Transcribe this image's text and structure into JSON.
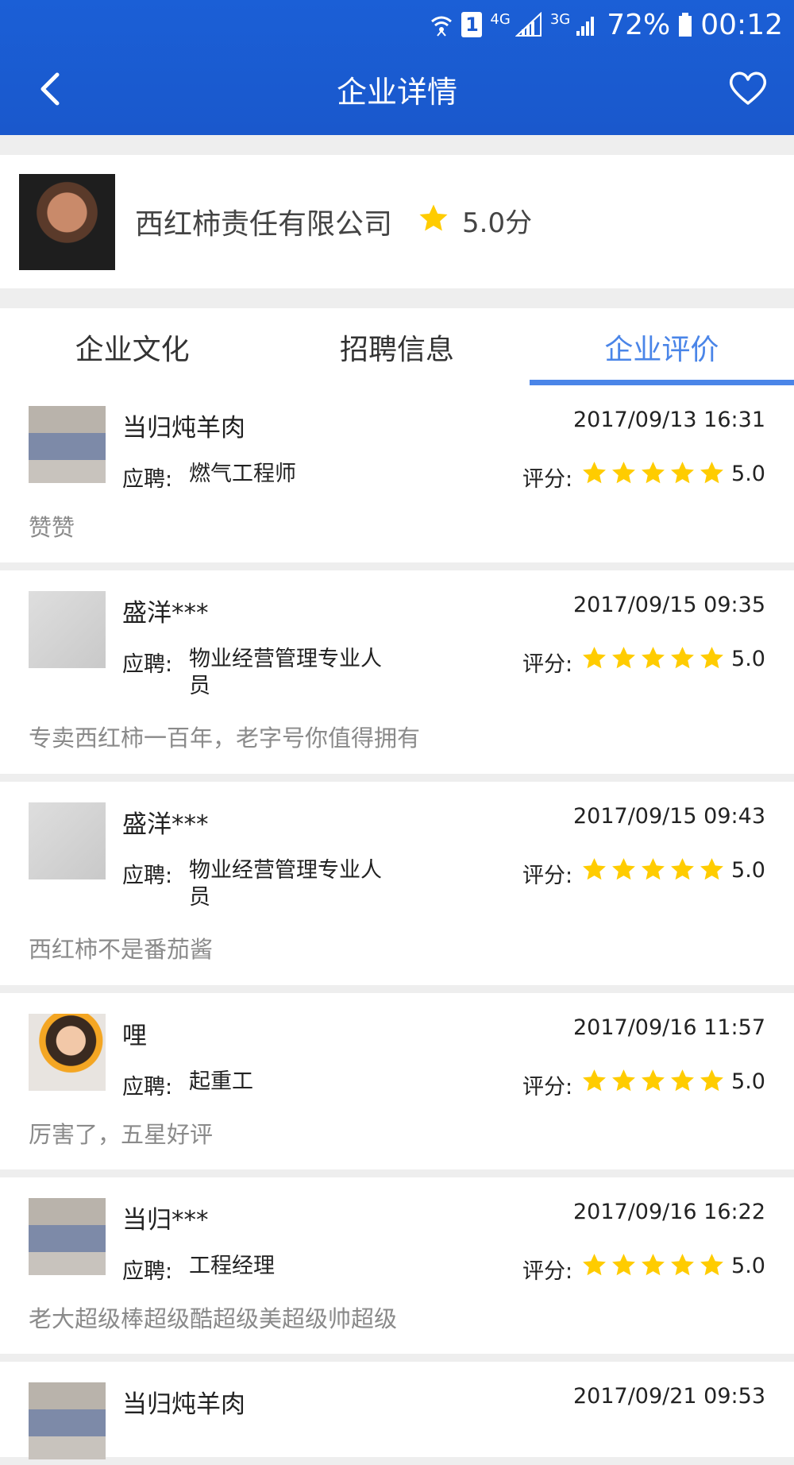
{
  "status_bar": {
    "network1": "4G",
    "network2": "3G",
    "sim": "1",
    "battery": "72%",
    "time": "00:12"
  },
  "header": {
    "title": "企业详情"
  },
  "company": {
    "name": "西红柿责任有限公司",
    "score": "5.0分"
  },
  "tabs": [
    {
      "label": "企业文化",
      "active": false
    },
    {
      "label": "招聘信息",
      "active": false
    },
    {
      "label": "企业评价",
      "active": true
    }
  ],
  "reviews": [
    {
      "name": "当归炖羊肉",
      "time": "2017/09/13 16:31",
      "apply_label": "应聘:",
      "position": "燃气工程师",
      "score_label": "评分:",
      "stars": 5,
      "score": "5.0",
      "comment": "赞赞",
      "avatar": "jeans"
    },
    {
      "name": "盛洋***",
      "time": "2017/09/15 09:35",
      "apply_label": "应聘:",
      "position": "物业经营管理专业人员",
      "score_label": "评分:",
      "stars": 5,
      "score": "5.0",
      "comment": "专卖西红柿一百年，老字号你值得拥有",
      "avatar": "sketch"
    },
    {
      "name": "盛洋***",
      "time": "2017/09/15 09:43",
      "apply_label": "应聘:",
      "position": "物业经营管理专业人员",
      "score_label": "评分:",
      "stars": 5,
      "score": "5.0",
      "comment": "西红柿不是番茄酱",
      "avatar": "sketch"
    },
    {
      "name": "哩",
      "time": "2017/09/16 11:57",
      "apply_label": "应聘:",
      "position": "起重工",
      "score_label": "评分:",
      "stars": 5,
      "score": "5.0",
      "comment": "厉害了，五星好评",
      "avatar": "girl"
    },
    {
      "name": "当归***",
      "time": "2017/09/16 16:22",
      "apply_label": "应聘:",
      "position": "工程经理",
      "score_label": "评分:",
      "stars": 5,
      "score": "5.0",
      "comment": "老大超级棒超级酷超级美超级帅超级",
      "avatar": "jeans"
    },
    {
      "name": "当归炖羊肉",
      "time": "2017/09/21 09:53",
      "apply_label": "",
      "position": "",
      "score_label": "",
      "stars": 0,
      "score": "",
      "comment": "",
      "avatar": "jeans"
    }
  ]
}
